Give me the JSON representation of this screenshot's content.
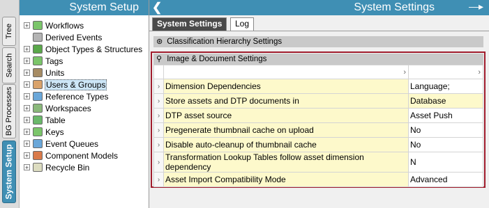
{
  "vertical_tabs": [
    "Tree",
    "Search",
    "BG Processes",
    "System Setup"
  ],
  "left_panel": {
    "title": "System Setup",
    "tree": [
      {
        "label": "Workflows",
        "expandable": true,
        "icon_color": "#7bc56a",
        "icon": "workflow-icon"
      },
      {
        "label": "Derived Events",
        "expandable": false,
        "icon_color": "#b4b4b4",
        "icon": "events-icon"
      },
      {
        "label": "Object Types & Structures",
        "expandable": true,
        "icon_color": "#5aa84a",
        "icon": "object-types-icon"
      },
      {
        "label": "Tags",
        "expandable": true,
        "icon_color": "#7bc56a",
        "icon": "tag-icon"
      },
      {
        "label": "Units",
        "expandable": true,
        "icon_color": "#a68b63",
        "icon": "units-icon"
      },
      {
        "label": "Users & Groups",
        "expandable": true,
        "icon_color": "#d9a26a",
        "icon": "users-icon",
        "selected": true
      },
      {
        "label": "Reference Types",
        "expandable": true,
        "icon_color": "#6aa7d9",
        "icon": "reference-types-icon"
      },
      {
        "label": "Workspaces",
        "expandable": true,
        "icon_color": "#8ab87a",
        "icon": "workspace-icon"
      },
      {
        "label": "Table",
        "expandable": true,
        "icon_color": "#6ab86a",
        "icon": "table-icon"
      },
      {
        "label": "Keys",
        "expandable": true,
        "icon_color": "#7bc56a",
        "icon": "key-icon"
      },
      {
        "label": "Event Queues",
        "expandable": true,
        "icon_color": "#6aa7d9",
        "icon": "event-queue-icon"
      },
      {
        "label": "Component Models",
        "expandable": true,
        "icon_color": "#d97a4a",
        "icon": "component-models-icon"
      },
      {
        "label": "Recycle Bin",
        "expandable": true,
        "icon_color": "#dcdcc0",
        "icon": "recycle-bin-icon"
      }
    ]
  },
  "right_panel": {
    "title": "System Settings",
    "tabs": [
      "System Settings",
      "Log"
    ],
    "sections": {
      "classification": "Classification Hierarchy Settings",
      "image_document": "Image & Document Settings"
    },
    "grid_header": {
      "name_col": "›",
      "value_col": "›"
    },
    "rows": [
      {
        "name": "Dimension Dependencies",
        "value": "Language;",
        "value_bg": "white"
      },
      {
        "name": "Store assets and DTP documents in",
        "value": "Database",
        "value_bg": "yellow"
      },
      {
        "name": "DTP asset source",
        "value": "Asset Push",
        "value_bg": "white"
      },
      {
        "name": "Pregenerate thumbnail cache on upload",
        "value": "No",
        "value_bg": "white"
      },
      {
        "name": "Disable auto-cleanup of thumbnail cache",
        "value": "No",
        "value_bg": "white"
      },
      {
        "name": "Transformation Lookup Tables follow asset dimension dependency",
        "value": "N",
        "value_bg": "white"
      },
      {
        "name": "Asset Import Compatibility Mode",
        "value": "Advanced",
        "value_bg": "white"
      }
    ]
  },
  "colors": {
    "header_blue": "#3f8fb4",
    "highlight_border": "#a01c2c",
    "row_yellow": "#fdf9cb"
  }
}
